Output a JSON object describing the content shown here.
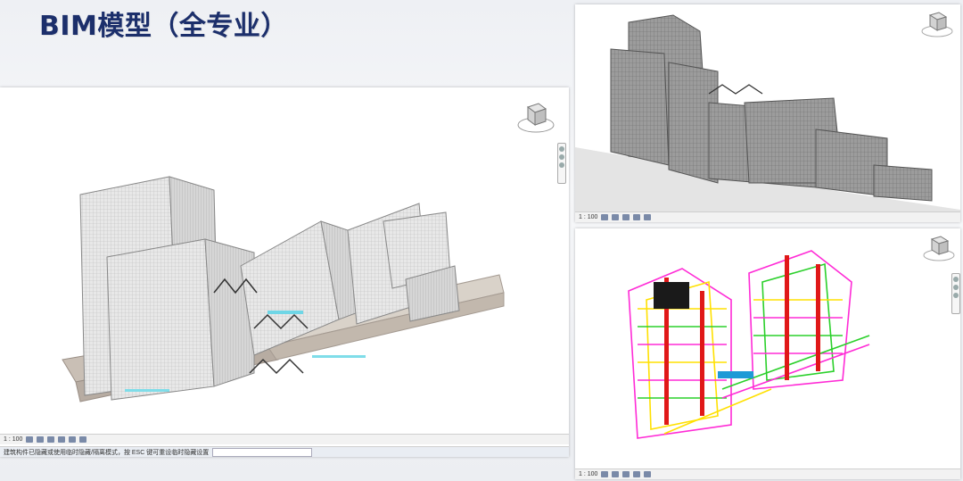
{
  "slide": {
    "title": "BIM模型（全专业）"
  },
  "viewports": {
    "main": {
      "status_scale": "1 : 100",
      "bottom_status_text": "建筑构件已隐藏或使用临时隐藏/隔离模式，按 ESC 键可重设临时隐藏设置"
    },
    "top_right": {
      "status_scale": "1 : 100"
    },
    "bottom_right": {
      "status_scale": "1 : 100"
    }
  },
  "colors": {
    "title": "#1c2f6b",
    "building_gray": "#8f8f8f",
    "mep_magenta": "#ff2bd6",
    "mep_yellow": "#ffe000",
    "mep_green": "#2bd02b",
    "mep_red": "#e01818"
  },
  "icons": [
    "view-cube-icon",
    "navigation-bar-icon",
    "visual-style-icon",
    "sun-path-icon",
    "shadows-icon",
    "crop-icon",
    "hide-icon"
  ]
}
